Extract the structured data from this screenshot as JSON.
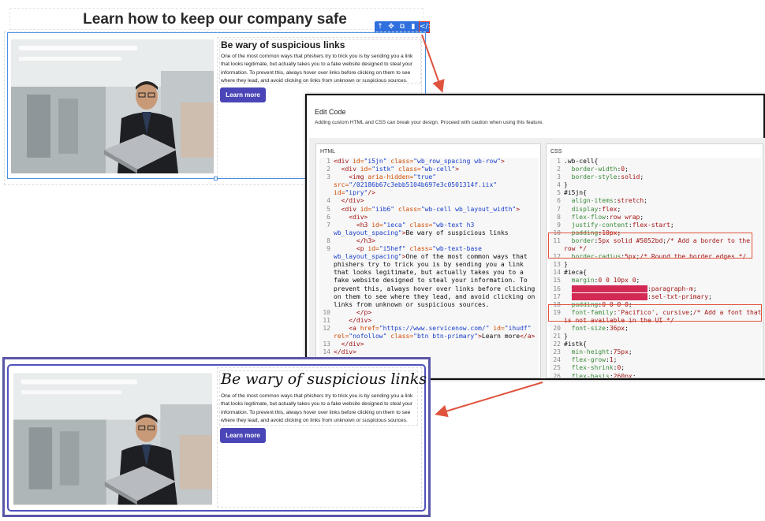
{
  "top": {
    "title": "Learn how to keep our company safe",
    "toolbar": {
      "icons": [
        "arrow-up-icon",
        "move-icon",
        "copy-icon",
        "delete-icon",
        "code-icon"
      ],
      "glyphs": [
        "↑",
        "✥",
        "⧉",
        "▮",
        "</>"
      ]
    },
    "heading": "Be wary of suspicious links",
    "paragraph": "One of the most common ways that phishers try to trick you is by sending you a link that looks legitimate, but actually takes you to a fake website designed to steal your information. To prevent this, always hover over links before clicking on them to see where they lead, and avoid clicking on links from unknown or suspicious sources.",
    "button": "Learn more"
  },
  "dialog": {
    "title": "Edit Code",
    "warning": "Adding custom HTML and CSS can break your design. Proceed with caution when using this feature.",
    "html_label": "HTML",
    "css_label": "CSS"
  },
  "bottom": {
    "heading": "Be wary of suspicious links",
    "paragraph": "One of the most common ways that phishers try to trick you is by sending you a link that looks legitimate, but actually takes you to a fake website designed to steal your information. To prevent this, always hover over links before clicking on them to see where they lead, and avoid clicking on links from unknown or suspicious sources.",
    "button": "Learn more"
  },
  "colors": {
    "accent": "#4a46b7",
    "border_highlight": "#5052bd",
    "annotation": "#e0543e",
    "selection": "#4a90e2"
  }
}
